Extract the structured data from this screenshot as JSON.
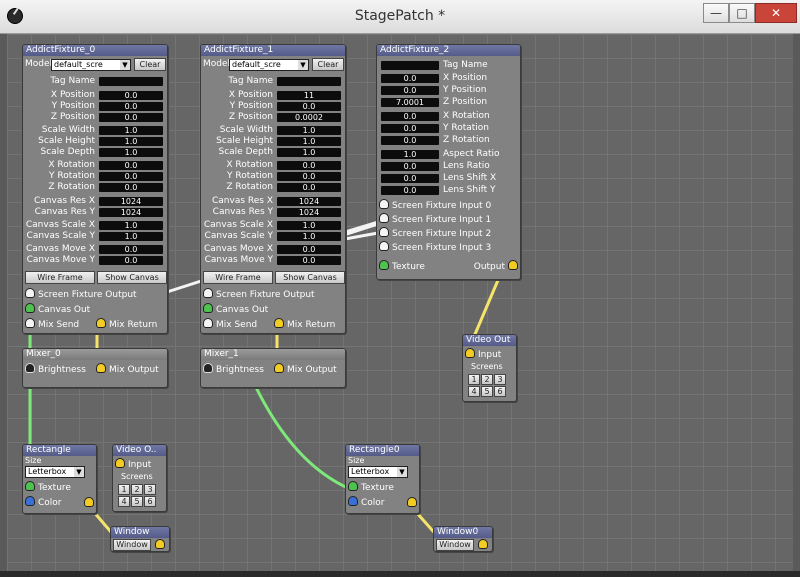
{
  "window": {
    "title": "StagePatch *",
    "min": "—",
    "max": "□",
    "close": "✕"
  },
  "colors": {
    "title_bar": "#6f77a4",
    "wire_green": "#7fe87a",
    "wire_yellow": "#f5e36a",
    "wire_white": "#f4f4f4"
  },
  "fixture_labels": {
    "model": "Model",
    "model_value": "default_scre",
    "clear": "Clear",
    "tag_name": "Tag Name",
    "x_pos": "X Position",
    "y_pos": "Y Position",
    "z_pos": "Z Position",
    "scale_w": "Scale Width",
    "scale_h": "Scale Height",
    "scale_d": "Scale Depth",
    "x_rot": "X Rotation",
    "y_rot": "Y Rotation",
    "z_rot": "Z Rotation",
    "res_x": "Canvas Res X",
    "res_y": "Canvas Res Y",
    "cscale_x": "Canvas Scale X",
    "cscale_y": "Canvas Scale Y",
    "move_x": "Canvas Move X",
    "move_y": "Canvas Move Y",
    "wire_frame": "Wire Frame",
    "show_canvas": "Show Canvas",
    "sfo": "Screen Fixture Output",
    "canvas_out": "Canvas Out",
    "mix_send": "Mix Send",
    "mix_return": "Mix Return"
  },
  "fixture0": {
    "title": "AddictFixture_0",
    "x": "0.0",
    "y": "0.0",
    "z": "0.0",
    "sw": "1.0",
    "sh": "1.0",
    "sd": "1.0",
    "rx": "0.0",
    "ry": "0.0",
    "rz": "0.0",
    "resx": "1024",
    "resy": "1024",
    "csx": "1.0",
    "csy": "1.0",
    "cmx": "0.0",
    "cmy": "0.0"
  },
  "fixture1": {
    "title": "AddictFixture_1",
    "x": "11",
    "y": "0.0",
    "z": "0.0002",
    "sw": "1.0",
    "sh": "1.0",
    "sd": "1.0",
    "rx": "0.0",
    "ry": "0.0",
    "rz": "0.0",
    "resx": "1024",
    "resy": "1024",
    "csx": "1.0",
    "csy": "1.0",
    "cmx": "0.0",
    "cmy": "0.0"
  },
  "fixture2": {
    "title": "AddictFixture_2",
    "labels": {
      "tag": "Tag Name",
      "x_pos": "X Position",
      "y_pos": "Y Position",
      "z_pos": "Z Position",
      "x_rot": "X Rotation",
      "y_rot": "Y Rotation",
      "z_rot": "Z Rotation",
      "aspect": "Aspect Ratio",
      "lens": "Lens Ratio",
      "shx": "Lens Shift X",
      "shy": "Lens Shift Y",
      "in0": "Screen Fixture Input 0",
      "in1": "Screen Fixture Input 1",
      "in2": "Screen Fixture Input 2",
      "in3": "Screen Fixture Input 3",
      "texture": "Texture",
      "output": "Output"
    },
    "x": "0.0",
    "y": "0.0",
    "z": "7.0001",
    "rx": "0.0",
    "ry": "0.0",
    "rz": "0.0",
    "aspect": "1.0",
    "lens": "0.0",
    "shx": "0.0",
    "shy": "0.0"
  },
  "mixer0": {
    "title": "Mixer_0",
    "brightness": "Brightness",
    "mix_output": "Mix Output"
  },
  "mixer1": {
    "title": "Mixer_1",
    "brightness": "Brightness",
    "mix_output": "Mix Output"
  },
  "videoout_a": {
    "title": "Video Out",
    "input": "Input",
    "screens": "Screens",
    "b": [
      "1",
      "2",
      "3",
      "4",
      "5",
      "6"
    ]
  },
  "videoout_b": {
    "title": "Video O..",
    "input": "Input",
    "screens": "Screens",
    "b": [
      "1",
      "2",
      "3",
      "4",
      "5",
      "6"
    ]
  },
  "rect_a": {
    "title": "Rectangle",
    "size": "Size",
    "size_value": "Letterbox",
    "texture": "Texture",
    "color": "Color"
  },
  "rect_b": {
    "title": "Rectangle0",
    "size": "Size",
    "size_value": "Letterbox",
    "texture": "Texture",
    "color": "Color"
  },
  "window_a": {
    "title": "Window",
    "button": "Window"
  },
  "window_b": {
    "title": "Window0",
    "button": "Window"
  }
}
